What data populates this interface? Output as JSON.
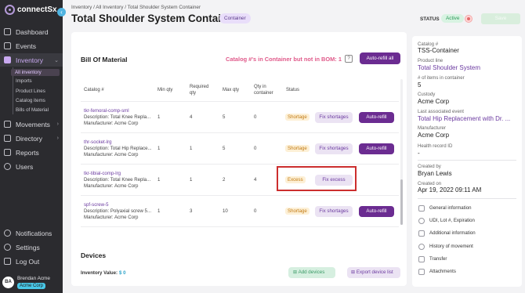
{
  "app": {
    "brand": "connectSx"
  },
  "sidebar": {
    "items": [
      {
        "label": "Dashboard",
        "icon": "dashboard-icon"
      },
      {
        "label": "Events",
        "icon": "calendar-icon"
      },
      {
        "label": "Inventory",
        "icon": "inventory-icon"
      },
      {
        "label": "Movements",
        "icon": "movements-icon"
      },
      {
        "label": "Directory",
        "icon": "directory-icon"
      },
      {
        "label": "Reports",
        "icon": "reports-icon"
      },
      {
        "label": "Users",
        "icon": "users-icon"
      },
      {
        "label": "Notifications",
        "icon": "bell-icon"
      },
      {
        "label": "Settings",
        "icon": "gear-icon"
      },
      {
        "label": "Log Out",
        "icon": "logout-icon"
      }
    ],
    "inventory_sub": [
      "All inventory",
      "Imports",
      "Product Lines",
      "Catalog items",
      "Bills of Material"
    ],
    "user": {
      "initials": "BA",
      "name": "Brendan Acme",
      "org": "Acme Corp"
    }
  },
  "header": {
    "breadcrumb": [
      "Inventory",
      "All Inventory",
      "Total Shoulder System Container"
    ],
    "title": "Total Shoulder System Container",
    "type_chip": "Container",
    "status_label": "STATUS",
    "status_value": "Active",
    "save_label": "Save"
  },
  "bom": {
    "title": "Bill Of Material",
    "warning": "Catalog #'s in Container but not in BOM: 1",
    "auto_refill_all": "Auto-refill all",
    "columns": [
      "Catalog #",
      "Min qty",
      "Required qty",
      "Max qty",
      "Qty in container",
      "Status"
    ],
    "rows": [
      {
        "catalog": "tkr-femoral-comp-sml",
        "description": "Description: Total Knee Repla...",
        "manufacturer": "Manufacturer: Acme Corp",
        "min": "1",
        "required": "4",
        "max": "5",
        "qty": "0",
        "status": "Shortage",
        "fix": "Fix shortages",
        "auto": "Auto-refill"
      },
      {
        "catalog": "thr-socket-lrg",
        "description": "Description: Total Hip Replace...",
        "manufacturer": "Manufacturer: Acme Corp",
        "min": "1",
        "required": "1",
        "max": "5",
        "qty": "0",
        "status": "Shortage",
        "fix": "Fix shortages",
        "auto": "Auto-refill"
      },
      {
        "catalog": "tkr-tibial-comp-lrg",
        "description": "Description: Total Knee Repla...",
        "manufacturer": "Manufacturer: Acme Corp",
        "min": "1",
        "required": "1",
        "max": "2",
        "qty": "4",
        "status": "Excess",
        "fix": "Fix excess",
        "auto": ""
      },
      {
        "catalog": "spf-screw-5",
        "description": "Description: Polyaxial screw 5...",
        "manufacturer": "Manufacturer: Acme Corp",
        "min": "1",
        "required": "3",
        "max": "10",
        "qty": "0",
        "status": "Shortage",
        "fix": "Fix shortages",
        "auto": "Auto-refill"
      }
    ]
  },
  "devices": {
    "title": "Devices",
    "inventory_label": "Inventory Value:",
    "inventory_value": "$ 0",
    "add_label": "Add devices",
    "export_label": "Export device list"
  },
  "panel": {
    "fields": [
      {
        "label": "Catalog #",
        "value": "TSS-Container",
        "link": false
      },
      {
        "label": "Product line",
        "value": "Total Shoulder System",
        "link": true
      },
      {
        "label": "# of items in container",
        "value": "5",
        "link": false
      },
      {
        "label": "Custody",
        "value": "Acme Corp",
        "link": false
      },
      {
        "label": "Last associated event",
        "value": "Total Hip Replacement with Dr. ...",
        "link": true
      },
      {
        "label": "Manufacturer",
        "value": "Acme Corp",
        "link": false
      },
      {
        "label": "Health record ID",
        "value": "-",
        "link": false
      }
    ],
    "created_by_label": "Created by",
    "created_by": "Bryan Lewis",
    "created_on_label": "Created on",
    "created_on": "Apr 19, 2022 09:11 AM",
    "actions": [
      "General information",
      "UDI, Lot #, Expiration",
      "Additional information",
      "History of movement",
      "Transfer",
      "Attachments"
    ]
  },
  "colors": {
    "accent": "#6b2c91",
    "shortage": "#c27a12",
    "warning": "#e05a8a",
    "active": "#2e9a5a"
  }
}
